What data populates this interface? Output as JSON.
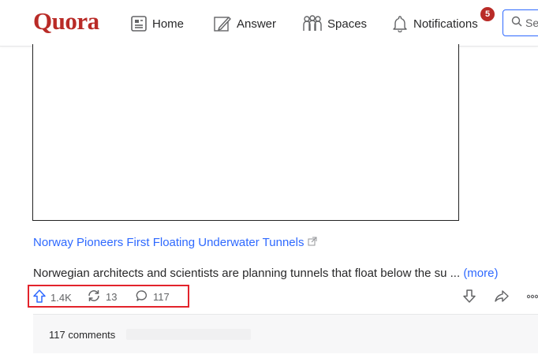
{
  "header": {
    "logo": "Quora",
    "nav": {
      "home": "Home",
      "answer": "Answer",
      "spaces": "Spaces",
      "notifications": "Notifications"
    },
    "notification_count": "5",
    "search_value": "Se"
  },
  "post": {
    "link_title": "Norway Pioneers First Floating Underwater Tunnels",
    "description": "Norwegian architects and scientists are planning tunnels that float below the su ... ",
    "more_label": "(more)",
    "upvotes": "1.4K",
    "shares": "13",
    "comments_count": "117",
    "comments_label": "117 comments"
  },
  "colors": {
    "brand": "#b92b27",
    "link": "#2e69ff",
    "highlight": "#e3232b"
  }
}
